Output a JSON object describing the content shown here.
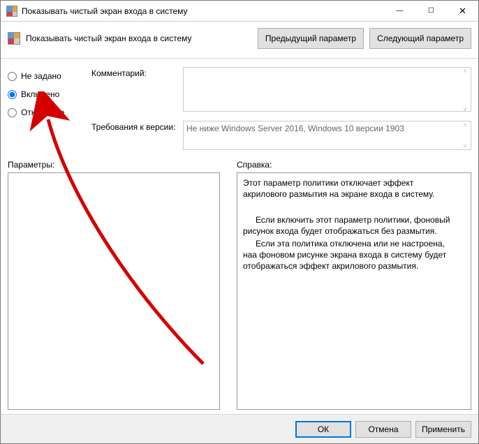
{
  "window": {
    "title": "Показывать чистый экран входа в систему"
  },
  "toolbar": {
    "label": "Показывать чистый экран входа в систему",
    "prev": "Предыдущий параметр",
    "next": "Следующий параметр"
  },
  "radios": {
    "not_configured": "Не задано",
    "enabled": "Включено",
    "disabled": "Отключено",
    "selected": "enabled"
  },
  "fields": {
    "comment_label": "Комментарий:",
    "comment_value": "",
    "requirements_label": "Требования к версии:",
    "requirements_value": "Не ниже Windows Server 2016, Windows 10 версии 1903"
  },
  "sections": {
    "params": "Параметры:",
    "help": "Справка:"
  },
  "help_text": {
    "p1": "Этот параметр политики отключает эффект акрилового размытия на экране входа в систему.",
    "p2": "Если включить этот параметр политики, фоновый рисунок входа будет отображаться без размытия.",
    "p3": "Если эта политика отключена или не настроена, наа фоновом рисунке экрана входа в систему будет отображаться эффект акрилового размытия."
  },
  "footer": {
    "ok": "ОК",
    "cancel": "Отмена",
    "apply": "Применить"
  }
}
